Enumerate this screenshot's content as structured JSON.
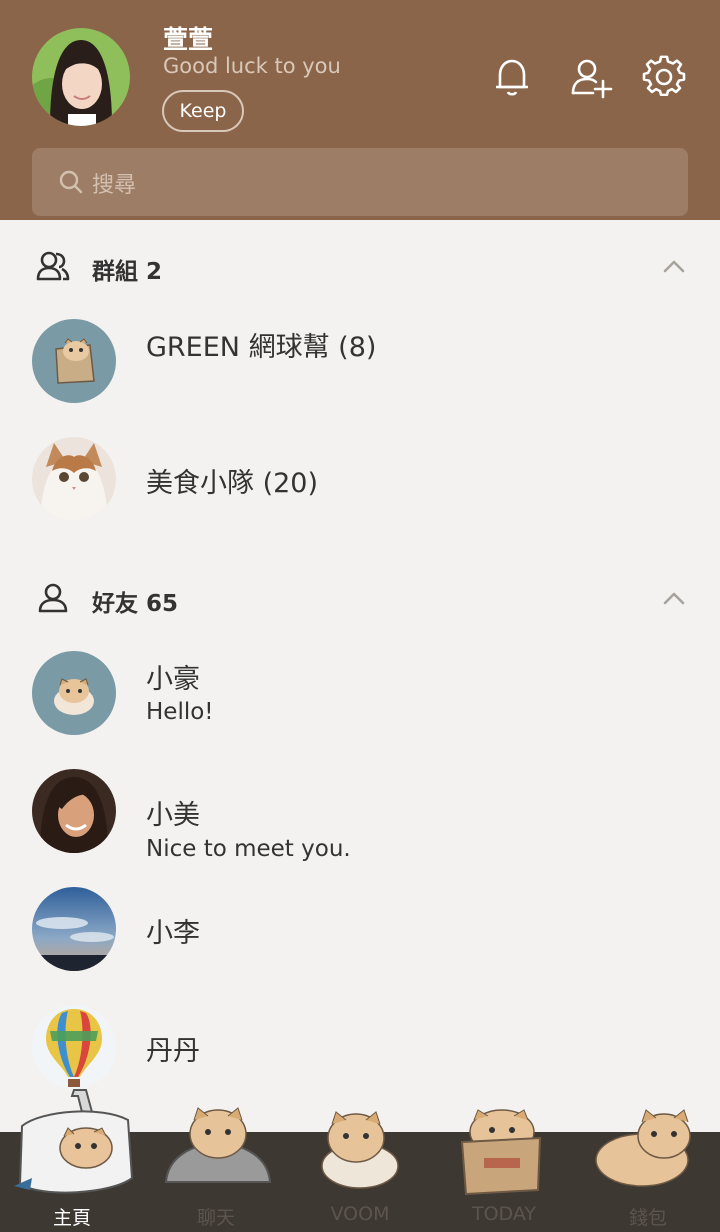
{
  "profile": {
    "name": "萱萱",
    "status": "Good luck to you",
    "keep_label": "Keep"
  },
  "header_icons": [
    "bell-icon",
    "add-friend-icon",
    "gear-icon"
  ],
  "search": {
    "placeholder": "搜尋"
  },
  "groups": {
    "title": "群組 2",
    "items": [
      {
        "name": "GREEN 網球幫 (8)"
      },
      {
        "name": "美食小隊 (20)"
      }
    ]
  },
  "friends": {
    "title": "好友 65",
    "items": [
      {
        "name": "小豪",
        "message": "Hello!"
      },
      {
        "name": "小美",
        "message": "Nice to meet you."
      },
      {
        "name": "小李",
        "message": ""
      },
      {
        "name": "丹丹",
        "message": ""
      }
    ]
  },
  "nav": {
    "items": [
      {
        "label": "主頁",
        "active": true
      },
      {
        "label": "聊天",
        "active": false
      },
      {
        "label": "VOOM",
        "active": false
      },
      {
        "label": "TODAY",
        "active": false
      },
      {
        "label": "錢包",
        "active": false
      }
    ]
  },
  "colors": {
    "header_bg": "#8a6549",
    "search_bg": "#9d7d65",
    "list_bg": "#f3f2f0",
    "nav_bg": "#3e3833",
    "text": "#333333"
  }
}
